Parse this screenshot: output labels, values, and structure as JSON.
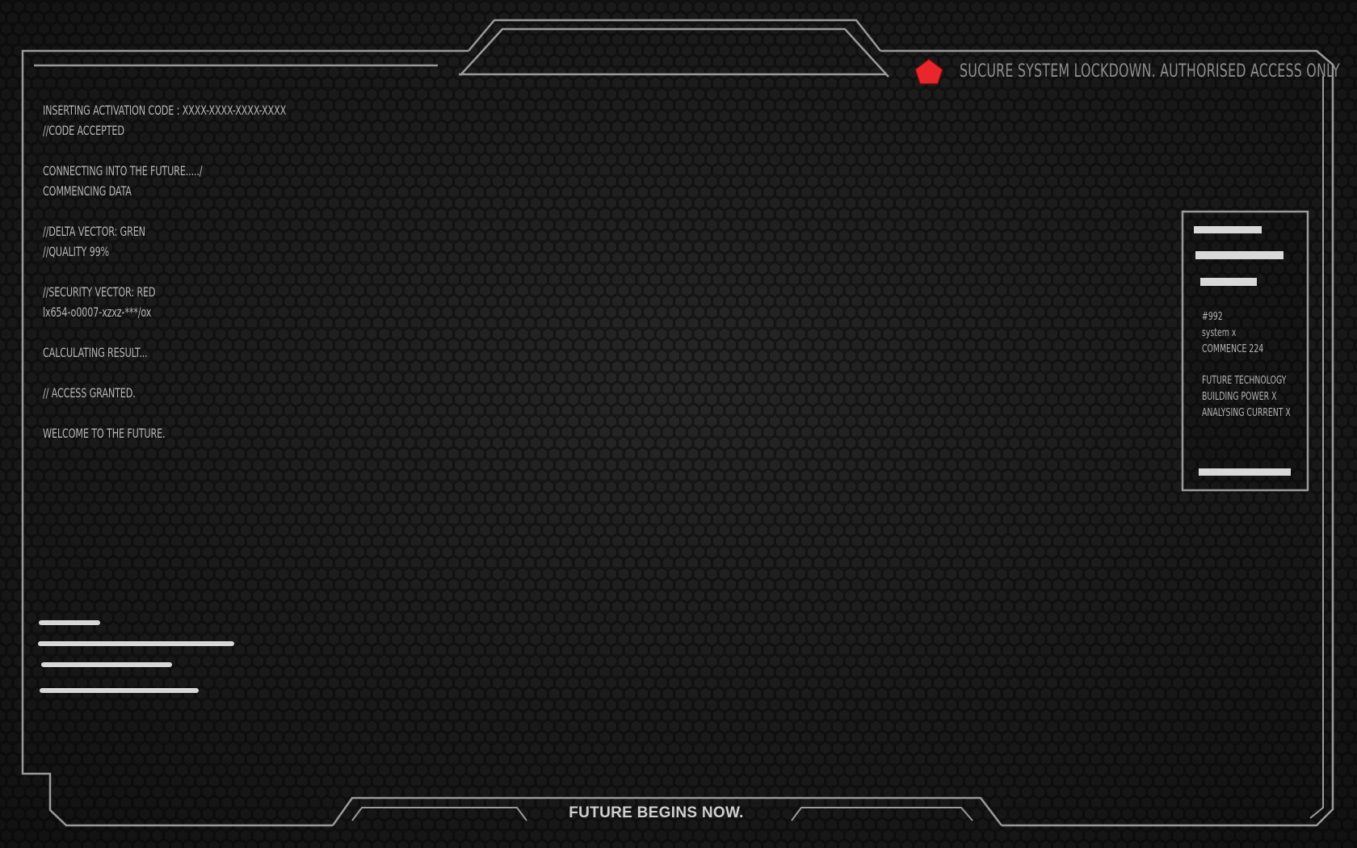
{
  "terminal": {
    "lines": [
      "INSERTING ACTIVATION CODE : XXXX-XXXX-XXXX-XXXX",
      "//CODE ACCEPTED",
      "",
      "CONNECTING INTO THE FUTURE...../",
      "COMMENCING DATA",
      "",
      "//DELTA VECTOR: GREN",
      "//QUALITY 99%",
      "",
      "//SECURITY VECTOR: RED",
      "lx654-o0007-xzxz-***/ox",
      "",
      "CALCULATING RESULT...",
      "",
      "// ACCESS GRANTED.",
      "",
      "WELCOME TO THE FUTURE."
    ]
  },
  "header": {
    "lockdown_text": "SUCURE SYSTEM LOCKDOWN.  AUTHORISED ACCESS ONLY",
    "alert_icon": "red-pentagon-icon"
  },
  "side_panel": {
    "group1": [
      "#992",
      "system x",
      "COMMENCE 224"
    ],
    "group2": [
      "FUTURE TECHNOLOGY",
      "BUILDING POWER X",
      "ANALYSING CURRENT X"
    ]
  },
  "footer": {
    "text": "FUTURE BEGINS NOW."
  },
  "colors": {
    "background": "#1a1a1a",
    "frame_line": "#9a9a9a",
    "text": "#b7b7b7",
    "alert": "#e8262b"
  }
}
